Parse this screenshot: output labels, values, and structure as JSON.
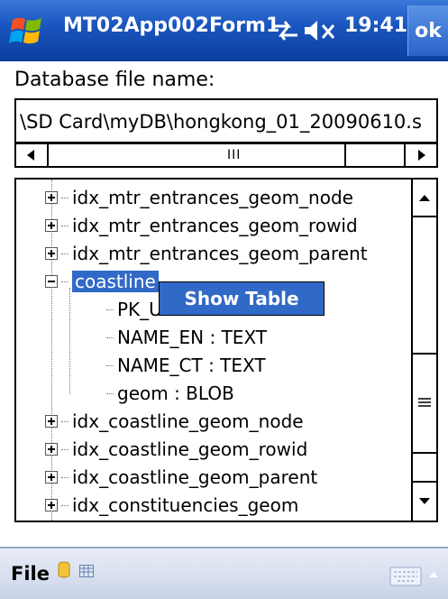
{
  "titlebar": {
    "app_title": "MT02App002Form1",
    "clock": "19:41",
    "ok_label": "ok",
    "start_icon": "windows-flag-icon",
    "connectivity_icon": "connectivity-icon",
    "volume_icon": "volume-muted-icon"
  },
  "form": {
    "db_label": "Database file name:",
    "db_path": "\\SD Card\\myDB\\hongkong_01_20090610.s",
    "hscroll_grip": "III"
  },
  "tree": {
    "items": [
      {
        "label": "idx_mtr_entrances_geom_node",
        "expander": "plus"
      },
      {
        "label": "idx_mtr_entrances_geom_rowid",
        "expander": "plus"
      },
      {
        "label": "idx_mtr_entrances_geom_parent",
        "expander": "plus"
      },
      {
        "label": "coastline",
        "expander": "minus",
        "selected": true
      },
      {
        "label": "PK_U",
        "child": true
      },
      {
        "label": "NAME_EN : TEXT",
        "child": true
      },
      {
        "label": "NAME_CT : TEXT",
        "child": true
      },
      {
        "label": "geom : BLOB",
        "child": true
      },
      {
        "label": "idx_coastline_geom_node",
        "expander": "plus"
      },
      {
        "label": "idx_coastline_geom_rowid",
        "expander": "plus"
      },
      {
        "label": "idx_coastline_geom_parent",
        "expander": "plus"
      },
      {
        "label": "idx_constituencies_geom",
        "expander": "plus"
      }
    ]
  },
  "context_menu": {
    "show_table": "Show Table"
  },
  "menubar": {
    "file_label": "File",
    "db_icon": "database-icon",
    "table_icon": "table-icon",
    "keyboard_icon": "keyboard-icon"
  },
  "colors": {
    "title_bar": "#1a56c0",
    "selection": "#3169c6"
  }
}
